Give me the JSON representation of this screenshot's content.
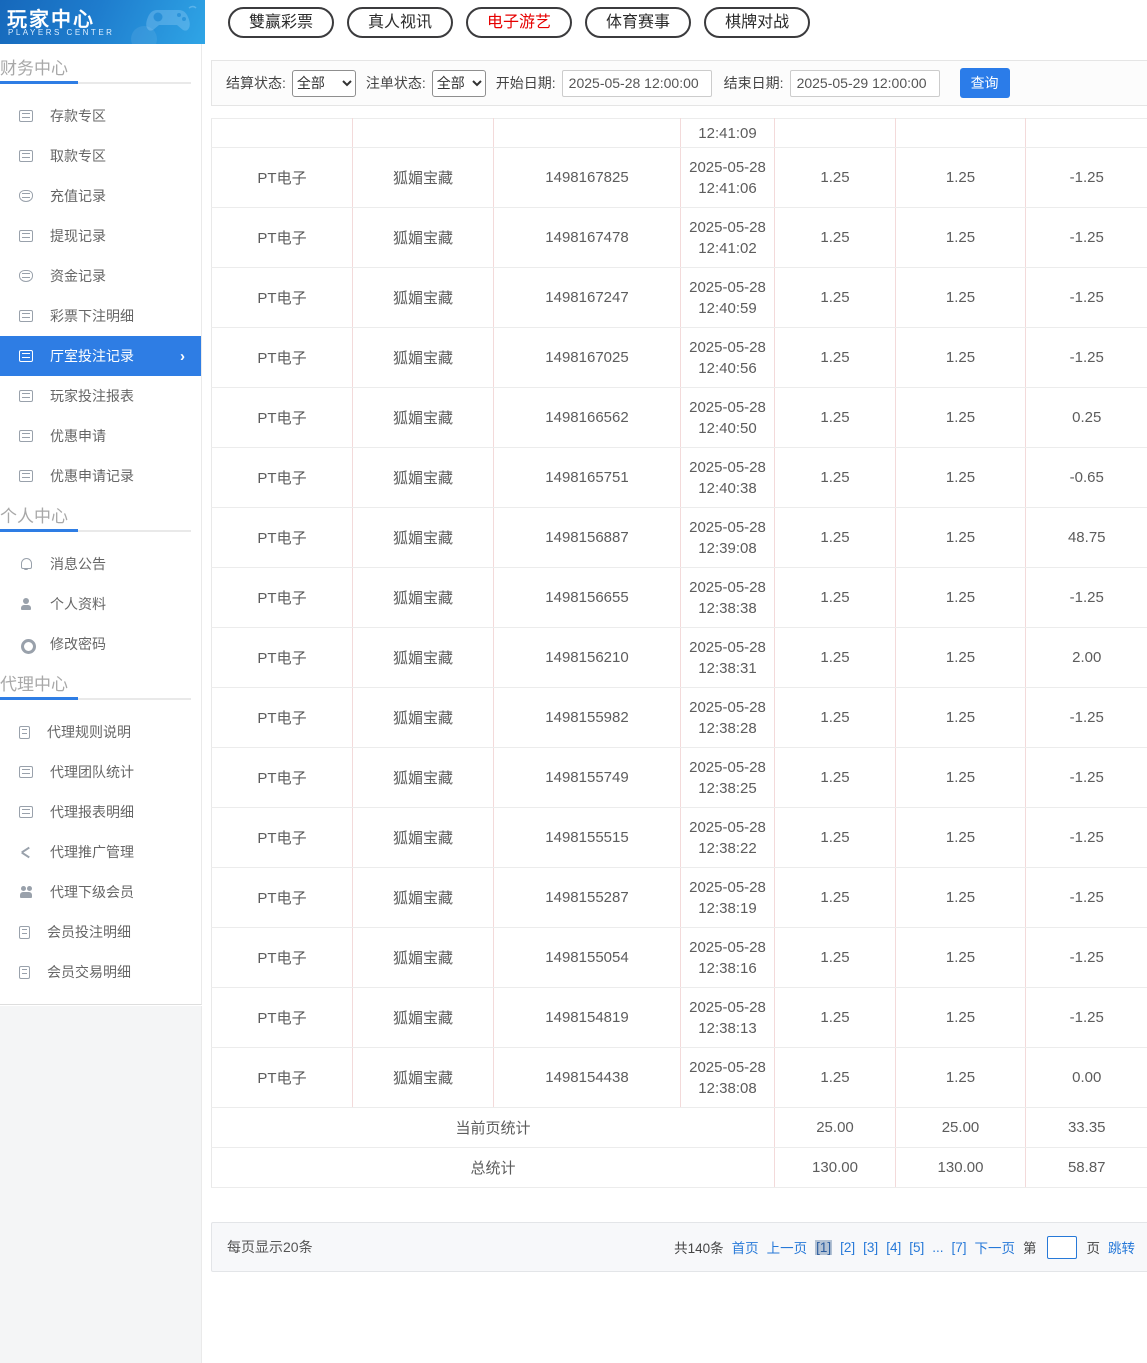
{
  "brand": {
    "title": "玩家中心",
    "subtitle": "PLAYERS CENTER"
  },
  "colors": {
    "accent_blue": "#2b7ce9",
    "sidebar_active_bg": "#2e7de4",
    "active_tab_red": "#e60000",
    "table_v_border": "#f3dada"
  },
  "top_tabs": [
    {
      "label": "雙赢彩票",
      "active": false
    },
    {
      "label": "真人视讯",
      "active": false
    },
    {
      "label": "电子游艺",
      "active": true
    },
    {
      "label": "体育赛事",
      "active": false
    },
    {
      "label": "棋牌对战",
      "active": false
    }
  ],
  "filters": {
    "settle_status_label": "结算状态:",
    "settle_status_value": "全部",
    "order_status_label": "注单状态:",
    "order_status_value": "全部",
    "start_label": "开始日期:",
    "start_value": "2025-05-28 12:00:00",
    "end_label": "结束日期:",
    "end_value": "2025-05-29 12:00:00",
    "search_label": "查询"
  },
  "sidebar": {
    "active_chevron": "›",
    "sections": [
      {
        "title": "财务中心",
        "items": [
          {
            "label": "存款专区",
            "icon": "card"
          },
          {
            "label": "取款专区",
            "icon": "hand"
          },
          {
            "label": "充值记录",
            "icon": "bag"
          },
          {
            "label": "提现记录",
            "icon": "wallet"
          },
          {
            "label": "资金记录",
            "icon": "purse"
          },
          {
            "label": "彩票下注明细",
            "icon": "list"
          },
          {
            "label": "厅室投注记录",
            "icon": "records",
            "active": true
          },
          {
            "label": "玩家投注报表",
            "icon": "chart"
          },
          {
            "label": "优惠申请",
            "icon": "ticket"
          },
          {
            "label": "优惠申请记录",
            "icon": "records"
          }
        ]
      },
      {
        "title": "个人中心",
        "items": [
          {
            "label": "消息公告",
            "icon": "bell"
          },
          {
            "label": "个人资料",
            "icon": "person"
          },
          {
            "label": "修改密码",
            "icon": "gear"
          }
        ]
      },
      {
        "title": "代理中心",
        "items": [
          {
            "label": "代理规则说明",
            "icon": "doc"
          },
          {
            "label": "代理团队统计",
            "icon": "report"
          },
          {
            "label": "代理报表明细",
            "icon": "report"
          },
          {
            "label": "代理推广管理",
            "icon": "share"
          },
          {
            "label": "代理下级会员",
            "icon": "people"
          },
          {
            "label": "会员投注明细",
            "icon": "doc-list"
          },
          {
            "label": "会员交易明细",
            "icon": "doc-list"
          }
        ]
      }
    ]
  },
  "table": {
    "partial_row_time": "12:41:09",
    "rows": [
      {
        "platform": "PT电子",
        "game": "狐媚宝藏",
        "order_no": "1498167825",
        "date": "2025-05-28",
        "time": "12:41:06",
        "bet": "1.25",
        "valid": "1.25",
        "winloss": "-1.25"
      },
      {
        "platform": "PT电子",
        "game": "狐媚宝藏",
        "order_no": "1498167478",
        "date": "2025-05-28",
        "time": "12:41:02",
        "bet": "1.25",
        "valid": "1.25",
        "winloss": "-1.25"
      },
      {
        "platform": "PT电子",
        "game": "狐媚宝藏",
        "order_no": "1498167247",
        "date": "2025-05-28",
        "time": "12:40:59",
        "bet": "1.25",
        "valid": "1.25",
        "winloss": "-1.25"
      },
      {
        "platform": "PT电子",
        "game": "狐媚宝藏",
        "order_no": "1498167025",
        "date": "2025-05-28",
        "time": "12:40:56",
        "bet": "1.25",
        "valid": "1.25",
        "winloss": "-1.25"
      },
      {
        "platform": "PT电子",
        "game": "狐媚宝藏",
        "order_no": "1498166562",
        "date": "2025-05-28",
        "time": "12:40:50",
        "bet": "1.25",
        "valid": "1.25",
        "winloss": "0.25"
      },
      {
        "platform": "PT电子",
        "game": "狐媚宝藏",
        "order_no": "1498165751",
        "date": "2025-05-28",
        "time": "12:40:38",
        "bet": "1.25",
        "valid": "1.25",
        "winloss": "-0.65"
      },
      {
        "platform": "PT电子",
        "game": "狐媚宝藏",
        "order_no": "1498156887",
        "date": "2025-05-28",
        "time": "12:39:08",
        "bet": "1.25",
        "valid": "1.25",
        "winloss": "48.75"
      },
      {
        "platform": "PT电子",
        "game": "狐媚宝藏",
        "order_no": "1498156655",
        "date": "2025-05-28",
        "time": "12:38:38",
        "bet": "1.25",
        "valid": "1.25",
        "winloss": "-1.25"
      },
      {
        "platform": "PT电子",
        "game": "狐媚宝藏",
        "order_no": "1498156210",
        "date": "2025-05-28",
        "time": "12:38:31",
        "bet": "1.25",
        "valid": "1.25",
        "winloss": "2.00"
      },
      {
        "platform": "PT电子",
        "game": "狐媚宝藏",
        "order_no": "1498155982",
        "date": "2025-05-28",
        "time": "12:38:28",
        "bet": "1.25",
        "valid": "1.25",
        "winloss": "-1.25"
      },
      {
        "platform": "PT电子",
        "game": "狐媚宝藏",
        "order_no": "1498155749",
        "date": "2025-05-28",
        "time": "12:38:25",
        "bet": "1.25",
        "valid": "1.25",
        "winloss": "-1.25"
      },
      {
        "platform": "PT电子",
        "game": "狐媚宝藏",
        "order_no": "1498155515",
        "date": "2025-05-28",
        "time": "12:38:22",
        "bet": "1.25",
        "valid": "1.25",
        "winloss": "-1.25"
      },
      {
        "platform": "PT电子",
        "game": "狐媚宝藏",
        "order_no": "1498155287",
        "date": "2025-05-28",
        "time": "12:38:19",
        "bet": "1.25",
        "valid": "1.25",
        "winloss": "-1.25"
      },
      {
        "platform": "PT电子",
        "game": "狐媚宝藏",
        "order_no": "1498155054",
        "date": "2025-05-28",
        "time": "12:38:16",
        "bet": "1.25",
        "valid": "1.25",
        "winloss": "-1.25"
      },
      {
        "platform": "PT电子",
        "game": "狐媚宝藏",
        "order_no": "1498154819",
        "date": "2025-05-28",
        "time": "12:38:13",
        "bet": "1.25",
        "valid": "1.25",
        "winloss": "-1.25"
      },
      {
        "platform": "PT电子",
        "game": "狐媚宝藏",
        "order_no": "1498154438",
        "date": "2025-05-28",
        "time": "12:38:08",
        "bet": "1.25",
        "valid": "1.25",
        "winloss": "0.00"
      }
    ],
    "page_summary": {
      "label": "当前页统计",
      "bet": "25.00",
      "valid": "25.00",
      "winloss": "33.35"
    },
    "total_summary": {
      "label": "总统计",
      "bet": "130.00",
      "valid": "130.00",
      "winloss": "58.87"
    }
  },
  "pagination": {
    "per_page": "每页显示20条",
    "total": "共140条",
    "first": "首页",
    "prev": "上一页",
    "pages": [
      "[1]",
      "[2]",
      "[3]",
      "[4]",
      "[5]",
      "...",
      "[7]"
    ],
    "current_page": "1",
    "next": "下一页",
    "jump_prefix": "第",
    "jump_suffix": "页",
    "jump_action": "跳转"
  }
}
